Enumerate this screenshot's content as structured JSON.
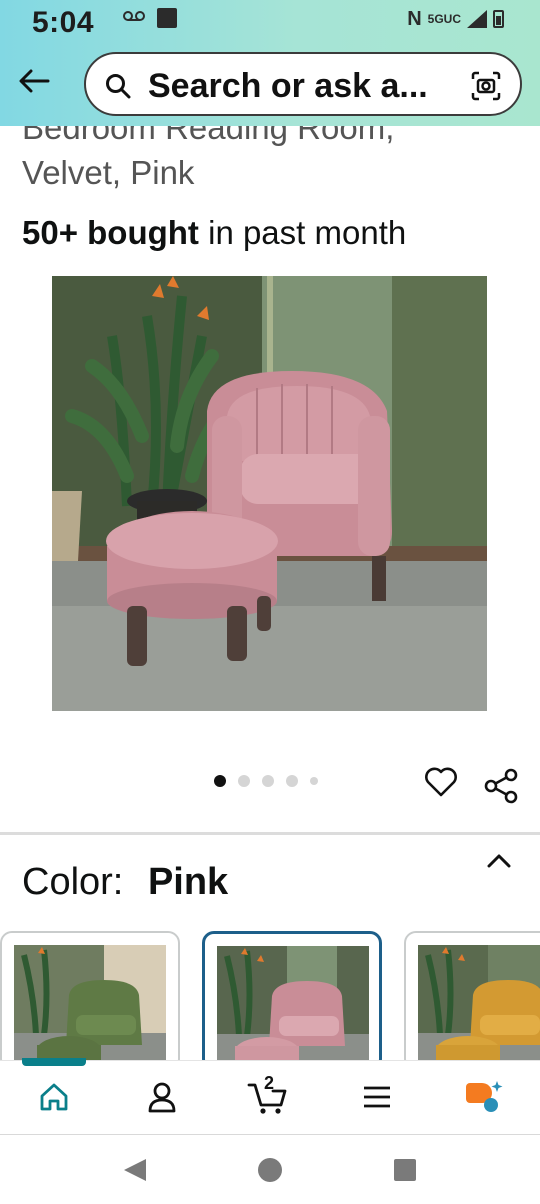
{
  "status_bar": {
    "time": "5:04",
    "nfc": "N",
    "network": "5GUC"
  },
  "search": {
    "text": "Search or ask a..."
  },
  "product": {
    "title_clipped": "Bedroom Reading Room,",
    "title_line2": "Velvet, Pink",
    "bought_bold": "50+ bought",
    "bought_rest": " in past month",
    "image_count": 5,
    "active_image": 1
  },
  "variation": {
    "label": "Color:",
    "value": "Pink",
    "options": [
      {
        "name": "Green",
        "color": "#5f7a45",
        "selected": false
      },
      {
        "name": "Pink",
        "color": "#d8a5ad",
        "selected": true
      },
      {
        "name": "Yellow",
        "color": "#d9a43a",
        "selected": false
      }
    ]
  },
  "bottom_nav": {
    "cart_count": "2",
    "items": [
      "home-icon",
      "account-icon",
      "cart-icon",
      "menu-icon",
      "rufus-icon"
    ],
    "accent": "#0a7f8a"
  },
  "system_nav": [
    "back-triangle-icon",
    "home-circle-icon",
    "recents-square-icon"
  ]
}
